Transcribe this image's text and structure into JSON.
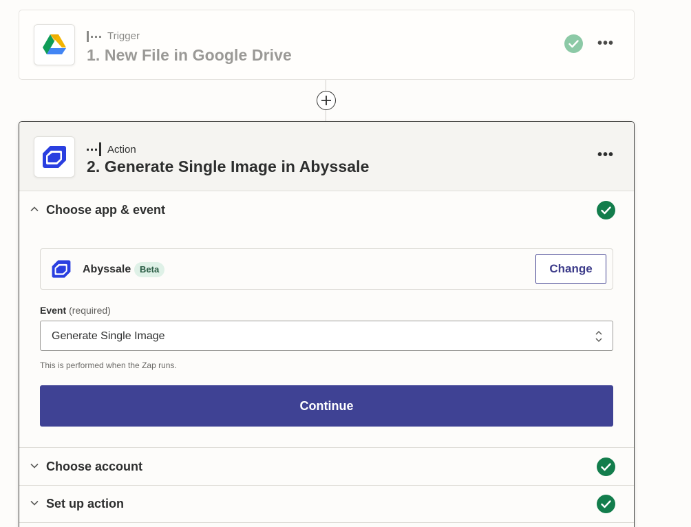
{
  "trigger": {
    "kind_label": "Trigger",
    "title": "1. New File in Google Drive",
    "icon": "google-drive-icon",
    "status": "complete"
  },
  "connector": {
    "add_icon": "plus-icon"
  },
  "action": {
    "kind_label": "Action",
    "title": "2. Generate Single Image in Abyssale",
    "icon": "abyssale-icon"
  },
  "sections": {
    "choose_app": {
      "label": "Choose app & event",
      "app_name": "Abyssale",
      "badge": "Beta",
      "change_label": "Change",
      "event_label": "Event",
      "event_required": "(required)",
      "event_value": "Generate Single Image",
      "event_help": "This is performed when the Zap runs.",
      "continue_label": "Continue"
    },
    "choose_account": {
      "label": "Choose account"
    },
    "set_up_action": {
      "label": "Set up action"
    }
  },
  "colors": {
    "primary": "#3f4294",
    "success": "#137d4c",
    "success_faded": "#8cc9a6",
    "abyssale_blue": "#2a3fe0"
  }
}
